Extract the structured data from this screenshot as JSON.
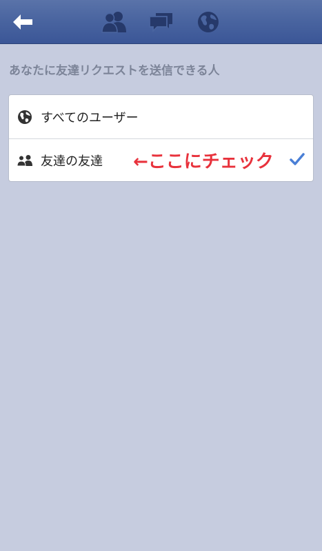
{
  "navbar": {
    "back_icon": "back-arrow-icon",
    "tabs": [
      {
        "icon": "friends-icon",
        "label": "Friend Requests"
      },
      {
        "icon": "messages-icon",
        "label": "Messages"
      },
      {
        "icon": "globe-icon",
        "label": "Notifications"
      }
    ],
    "color": "#3b5998"
  },
  "section": {
    "title": "あなたに友達リクエストを送信できる人"
  },
  "options": [
    {
      "label": "すべてのユーザー",
      "icon": "globe-icon",
      "selected": false
    },
    {
      "label": "友達の友達",
      "icon": "friends-icon",
      "selected": true
    }
  ],
  "annotation": {
    "text": "←ここにチェック",
    "color": "#e8323c"
  },
  "check_color": "#4a7fd6"
}
